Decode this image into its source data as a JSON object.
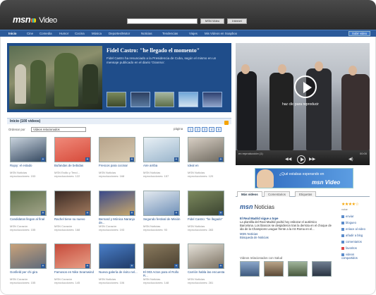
{
  "header": {
    "logo": "msn",
    "product": "Video",
    "search_placeholder": "",
    "search_buttons": [
      "MSN Video",
      "Internet"
    ]
  },
  "nav": {
    "items": [
      "Inicio",
      "Cine",
      "Comedia",
      "Humor",
      "Cocina",
      "Música",
      "Deportes/Motor",
      "Noticias",
      "Tendencias",
      "Viajes",
      "Mis Videos en Soapbox"
    ],
    "upload": "Subir video"
  },
  "hero": {
    "title": "Fidel Castro: \"he llegado el momento\"",
    "description": "Fidel Castro ha renunciado a la Presidencia de Cuba, según el mismo en un mensaje publicado en el diario 'Granma'."
  },
  "player": {
    "hint": "haz clic para reproducir",
    "status": "en reproducción (1)",
    "time": "00:00"
  },
  "ad": {
    "text": "¿Qué estabas esperando en",
    "brand": "msn Video"
  },
  "list": {
    "title": "Inicio (100 videos)",
    "sort_label": "Ordenar por",
    "sort_value": "Videos relacionados",
    "pager_label": "página",
    "pages": [
      "1",
      "2",
      "3",
      "4",
      "5"
    ],
    "tiles": [
      {
        "title": "Rajoy: el estado",
        "src": "MSN Noticias",
        "views": "reproducciones: 153"
      },
      {
        "title": "Bufandas de bebidas",
        "src": "MSN Estilo y Tend...",
        "views": "reproducciones: 122"
      },
      {
        "title": "Frescos para cocinar",
        "src": "MSN Noticias",
        "views": "reproducciones: 168"
      },
      {
        "title": "Aire arriba",
        "src": "MSN Noticias",
        "views": "reproducciones: 157"
      },
      {
        "title": "Ideal en",
        "src": "MSN Noticias",
        "views": "reproducciones: 120"
      },
      {
        "title": "Candidatos llegan al final",
        "src": "MSN Corazón",
        "views": "reproducciones: 155"
      },
      {
        "title": "Rachel tiene su nuevo",
        "src": "MSN Corazón",
        "views": "reproducciones: 168"
      },
      {
        "title": "Bernard y Mónica Naranjo de...",
        "src": "MSN Corazón",
        "views": "reproducciones: 193"
      },
      {
        "title": "Segundo festival de Misión",
        "src": "MSN Noticias",
        "views": "reproducciones: 93"
      },
      {
        "title": "Fidel Castro: \"he llegado\"",
        "src": "MSN Noticias",
        "views": "reproducciones: 283"
      },
      {
        "title": "Gosfield per chi gira",
        "src": "MSN Corazón",
        "views": "reproducciones: 155"
      },
      {
        "title": "Famosos en Nike Seamwind",
        "src": "MSN Corazón",
        "views": "reproducciones: 145"
      },
      {
        "title": "Nueva galería de éxito nel...",
        "src": "MSN Noticias",
        "views": "reproducciones: 106"
      },
      {
        "title": "El 003 Actos para el Rollo R...",
        "src": "MSN Noticias",
        "views": "reproducciones: 148"
      },
      {
        "title": "Carrión habla las encuesta",
        "src": "MSN Noticias",
        "views": "reproducciones: 281"
      }
    ]
  },
  "tabs": [
    "Más videos",
    "Comentarios",
    "Etiquetas"
  ],
  "news": {
    "brand": "msn",
    "title": "Noticias",
    "headline": "El Real Madrid sigue a tope",
    "body": "La plantilla del Real Madrid podrá hoy esbozar el auténtico Barcelona. Los blancos se despidieron tras la derrota en el choque de ida de la Champions League frente a la AS Roma en el...",
    "link": "MSN Noticias",
    "more": "Búsqueda de Noticias",
    "related_label": "Videos relacionados con Salud"
  },
  "actions": {
    "rating_stars": "★★★★☆",
    "rating_label": "votar",
    "items": [
      "enviar",
      "blogueo",
      "enlace al video",
      "añadir a blog",
      "comentarios",
      "favoritos",
      "videos compartidos"
    ]
  },
  "colors": {
    "topbar": "#2b2b2b",
    "navbar": "#2b5a9a",
    "accent": "#f5a300"
  }
}
